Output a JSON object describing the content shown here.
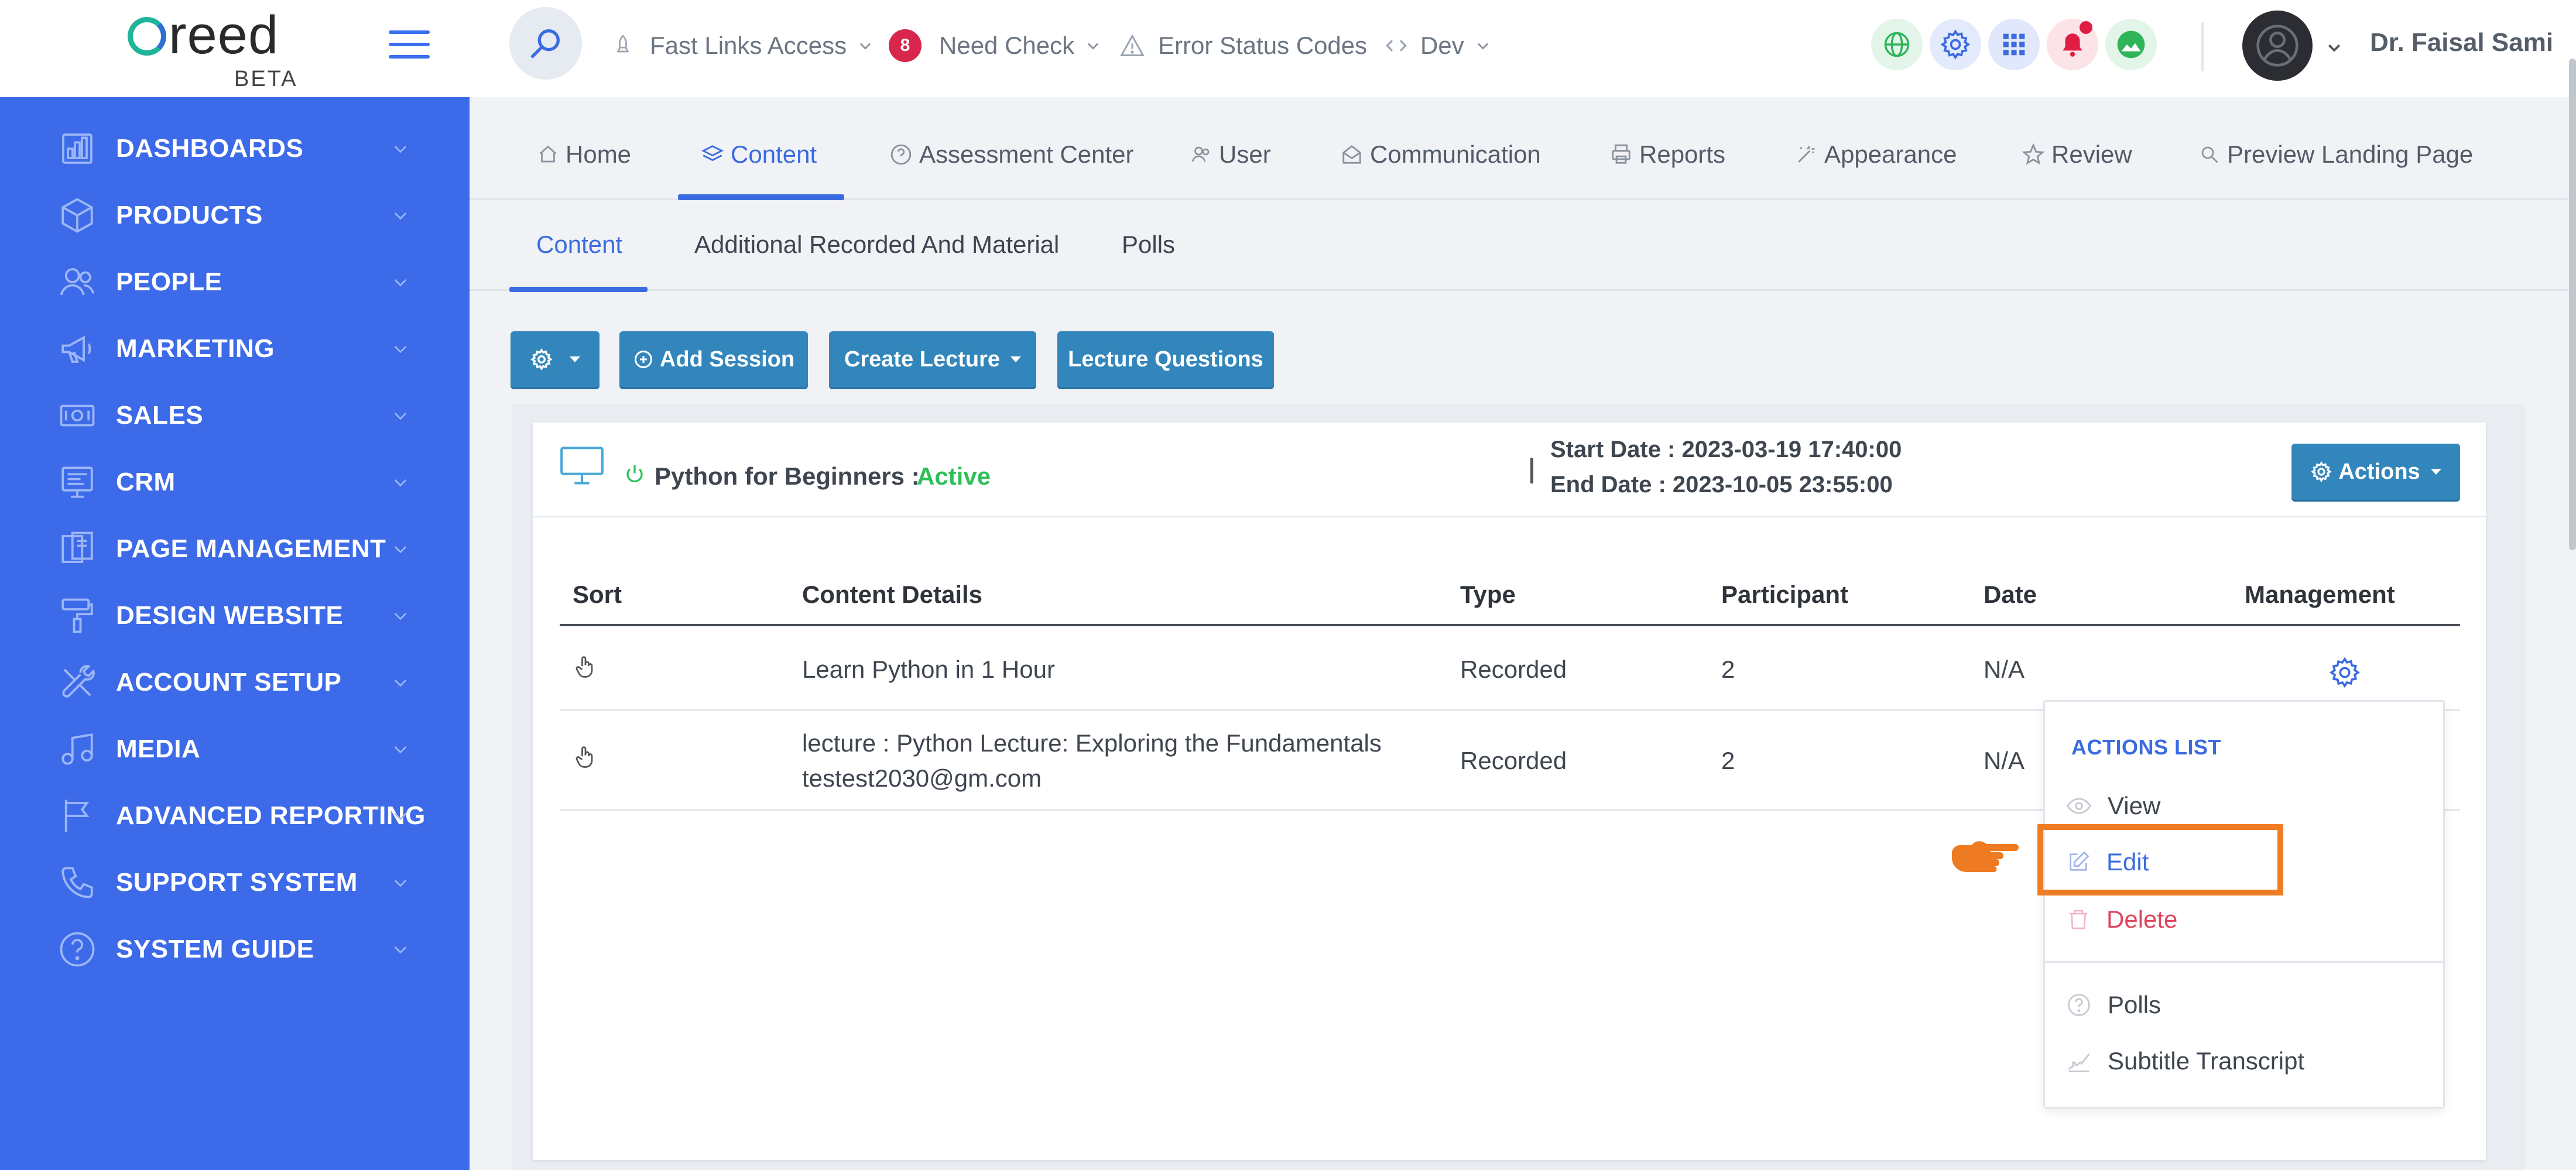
{
  "brand": {
    "logo_text": "reed",
    "logo_sub": "BETA"
  },
  "topbar": {
    "fast_links": "Fast Links Access",
    "need_check_count": "8",
    "need_check": "Need Check",
    "error_codes": "Error Status Codes",
    "dev": "Dev",
    "user_name": "Dr. Faisal Sami",
    "quick_icons": [
      "globe-icon",
      "gear-icon",
      "apps-grid-icon",
      "bell-icon",
      "gallery-icon"
    ]
  },
  "sidebar": {
    "items": [
      {
        "label": "DASHBOARDS",
        "icon": "chart-icon"
      },
      {
        "label": "PRODUCTS",
        "icon": "box-icon"
      },
      {
        "label": "PEOPLE",
        "icon": "people-icon"
      },
      {
        "label": "MARKETING",
        "icon": "megaphone-icon"
      },
      {
        "label": "SALES",
        "icon": "money-icon"
      },
      {
        "label": "CRM",
        "icon": "crm-icon"
      },
      {
        "label": "PAGE MANAGEMENT",
        "icon": "pages-icon"
      },
      {
        "label": "DESIGN WEBSITE",
        "icon": "paint-roller-icon"
      },
      {
        "label": "ACCOUNT SETUP",
        "icon": "tools-icon"
      },
      {
        "label": "MEDIA",
        "icon": "music-icon"
      },
      {
        "label": "ADVANCED REPORTING",
        "icon": "flag-icon"
      },
      {
        "label": "SUPPORT SYSTEM",
        "icon": "phone-icon"
      },
      {
        "label": "SYSTEM GUIDE",
        "icon": "question-icon"
      }
    ]
  },
  "main_tabs": [
    "Home",
    "Content",
    "Assessment Center",
    "User",
    "Communication",
    "Reports",
    "Appearance",
    "Review",
    "Preview Landing Page"
  ],
  "sub_tabs": [
    "Content",
    "Additional Recorded And Material",
    "Polls"
  ],
  "toolbar": {
    "add_session": "Add Session",
    "create_lecture": "Create Lecture",
    "lecture_questions": "Lecture Questions"
  },
  "course": {
    "title": "Python for Beginners :",
    "status": "Active",
    "start": "Start Date : 2023-03-19 17:40:00",
    "end": "End Date : 2023-10-05 23:55:00",
    "actions_label": "Actions"
  },
  "table": {
    "headers": [
      "Sort",
      "Content Details",
      "Type",
      "Participant",
      "Date",
      "Management"
    ],
    "rows": [
      {
        "details": "Learn Python in 1 Hour",
        "details2": "",
        "type": "Recorded",
        "participant": "2",
        "date": "N/A"
      },
      {
        "details": "lecture : Python Lecture: Exploring the Fundamentals",
        "details2": "testest2030@gm.com",
        "type": "Recorded",
        "participant": "2",
        "date": "N/A"
      }
    ]
  },
  "actions_menu": {
    "title": "ACTIONS LIST",
    "items": [
      "View",
      "Edit",
      "Delete",
      "Polls",
      "Subtitle Transcript"
    ]
  },
  "colors": {
    "sidebar": "#3c6ae8",
    "accent": "#3b6be0",
    "button": "#3386bb",
    "active_status": "#2fbf5a",
    "delete": "#e0455f",
    "highlight": "#f07d25"
  }
}
